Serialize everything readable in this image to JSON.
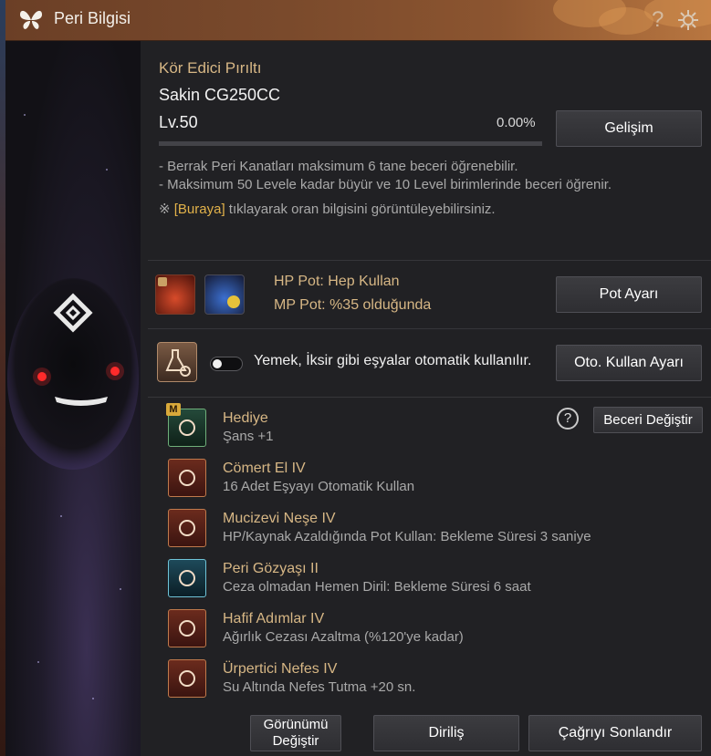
{
  "window": {
    "title": "Peri Bilgisi"
  },
  "pet": {
    "name": "Kör Edici Pırıltı",
    "stats": "Sakin CG250CC",
    "level": "Lv.50",
    "exp_percent": "0.00%",
    "exp_fraction": 0.0
  },
  "buttons": {
    "growth": "Gelişim",
    "pot_settings": "Pot Ayarı",
    "auto_use_settings": "Oto. Kullan Ayarı",
    "change_skill": "Beceri Değiştir",
    "change_look_line1": "Görünümü",
    "change_look_line2": "Değiştir",
    "revive": "Diriliş",
    "end_summon": "Çağrıyı Sonlandır"
  },
  "info": {
    "line1": "- Berrak Peri Kanatları maksimum 6 tane beceri öğrenebilir.",
    "line2": "- Maksimum 50 Levele kadar büyür ve 10 Level birimlerinde beceri öğrenir.",
    "note_prefix": "※ ",
    "note_link": "[Buraya]",
    "note_suffix": " tıklayarak oran bilgisini görüntüleyebilirsiniz."
  },
  "pots": {
    "hp": "HP Pot: Hep Kullan",
    "mp": "MP Pot: %35 olduğunda"
  },
  "auto_use": {
    "label": "Yemek, İksir gibi eşyalar otomatik kullanılır.",
    "enabled": false
  },
  "help_glyph": "?",
  "skills": [
    {
      "name": "Hediye",
      "desc": "Şans +1",
      "icon": "clover-icon",
      "badge": "M"
    },
    {
      "name": "Cömert El IV",
      "desc": "16 Adet Eşyayı Otomatik Kullan",
      "icon": "fairy-icon"
    },
    {
      "name": "Mucizevi Neşe IV",
      "desc": "HP/Kaynak Azaldığında Pot Kullan: Bekleme Süresi 3 saniye",
      "icon": "potion-plus-icon"
    },
    {
      "name": "Peri Gözyaşı II",
      "desc": "Ceza olmadan Hemen Diril: Bekleme Süresi 6 saat",
      "icon": "tear-icon"
    },
    {
      "name": "Hafif Adımlar IV",
      "desc": "Ağırlık Cezası Azaltma (%120'ye kadar)",
      "icon": "weight-icon"
    },
    {
      "name": "Ürpertici Nefes IV",
      "desc": "Su Altında Nefes Tutma +20 sn.",
      "icon": "breath-icon"
    }
  ],
  "colors": {
    "accent_gold": "#d7b785",
    "title_bar": "#7a4a2c",
    "progress_fill": "#c8a86a"
  }
}
